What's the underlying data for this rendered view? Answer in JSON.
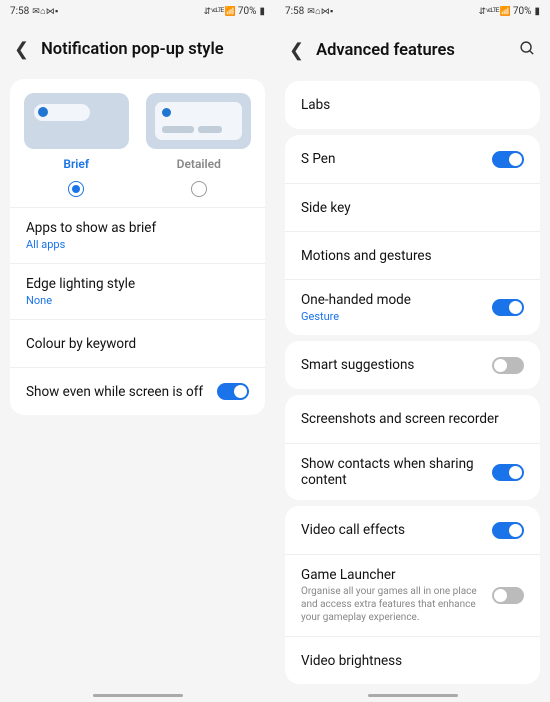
{
  "status": {
    "time": "7:58",
    "left_icons": "✉ ⌂ ⋈ ▪",
    "right_icons": "⇵ ᵛᵒᴸᵀᴱ 📶",
    "battery": "70%"
  },
  "left_screen": {
    "title": "Notification pop-up style",
    "options": {
      "brief": "Brief",
      "detailed": "Detailed"
    },
    "items": [
      {
        "title": "Apps to show as brief",
        "sub": "All apps"
      },
      {
        "title": "Edge lighting style",
        "sub": "None"
      },
      {
        "title": "Colour by keyword"
      },
      {
        "title": "Show even while screen is off",
        "toggle": true
      }
    ]
  },
  "right_screen": {
    "title": "Advanced features",
    "groups": [
      [
        {
          "title": "Labs"
        }
      ],
      [
        {
          "title": "S Pen",
          "toggle": true
        },
        {
          "title": "Side key"
        },
        {
          "title": "Motions and gestures"
        },
        {
          "title": "One-handed mode",
          "sub": "Gesture",
          "toggle": true
        }
      ],
      [
        {
          "title": "Smart suggestions",
          "toggle": false
        }
      ],
      [
        {
          "title": "Screenshots and screen recorder"
        },
        {
          "title": "Show contacts when sharing content",
          "toggle": true
        }
      ],
      [
        {
          "title": "Video call effects",
          "toggle": true
        },
        {
          "title": "Game Launcher",
          "desc": "Organise all your games all in one place and access extra features that enhance your gameplay experience.",
          "toggle": false
        },
        {
          "title": "Video brightness"
        }
      ]
    ]
  }
}
